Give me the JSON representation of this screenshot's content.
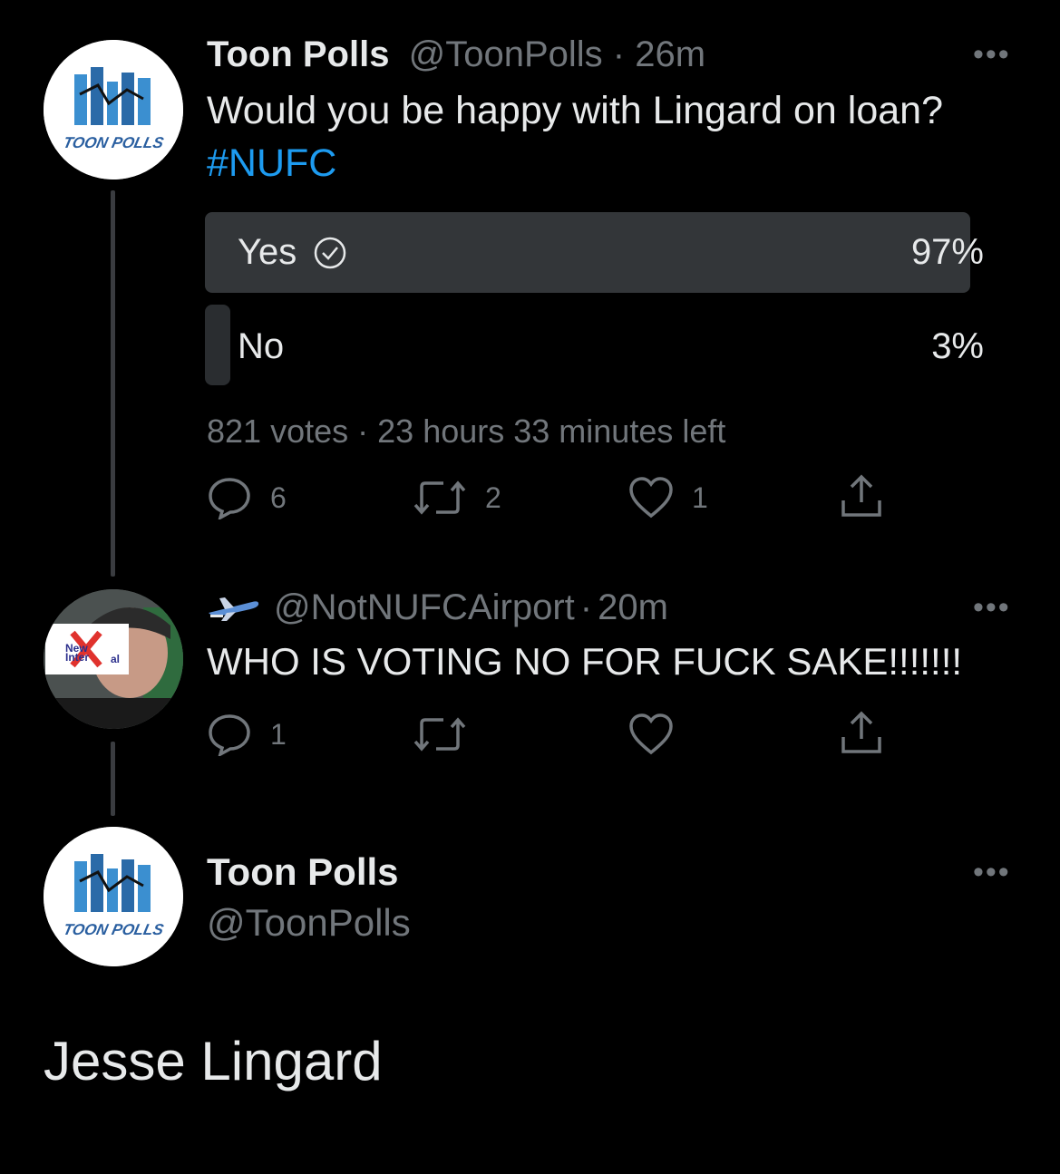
{
  "tweets": [
    {
      "name": "Toon Polls",
      "handle": "@ToonPolls",
      "sep": "·",
      "time": "26m",
      "text": "Would you be happy with Lingard on loan?",
      "hashtag": "#NUFC",
      "avatar_text": "TOON POLLS",
      "poll": {
        "options": [
          {
            "label": "Yes",
            "percent": "97%",
            "fraction": 0.97,
            "winner": true
          },
          {
            "label": "No",
            "percent": "3%",
            "fraction": 0.03,
            "winner": false
          }
        ],
        "votes": "821 votes",
        "sep": "·",
        "time_left": "23 hours 33 minutes left"
      },
      "actions": {
        "reply": "6",
        "retweet": "2",
        "like": "1"
      }
    },
    {
      "handle": "@NotNUFCAirport",
      "sep": "·",
      "time": "20m",
      "text": "WHO IS VOTING NO FOR FUCK SAKE!!!!!!!",
      "avatar_text_1": "New",
      "avatar_text_2": "Inter",
      "avatar_text_3": "al",
      "actions": {
        "reply": "1",
        "retweet": "",
        "like": ""
      }
    },
    {
      "name": "Toon Polls",
      "handle": "@ToonPolls",
      "avatar_text": "TOON POLLS",
      "text": "Jesse Lingard"
    }
  ],
  "colors": {
    "background": "#000000",
    "link": "#1d9bf0",
    "muted": "#71767b",
    "poll_winner": "#333639",
    "poll_loser": "#2a2d30"
  },
  "icons": [
    "reply-icon",
    "retweet-icon",
    "like-icon",
    "share-icon",
    "more-icon",
    "check-icon",
    "airplane-icon"
  ]
}
